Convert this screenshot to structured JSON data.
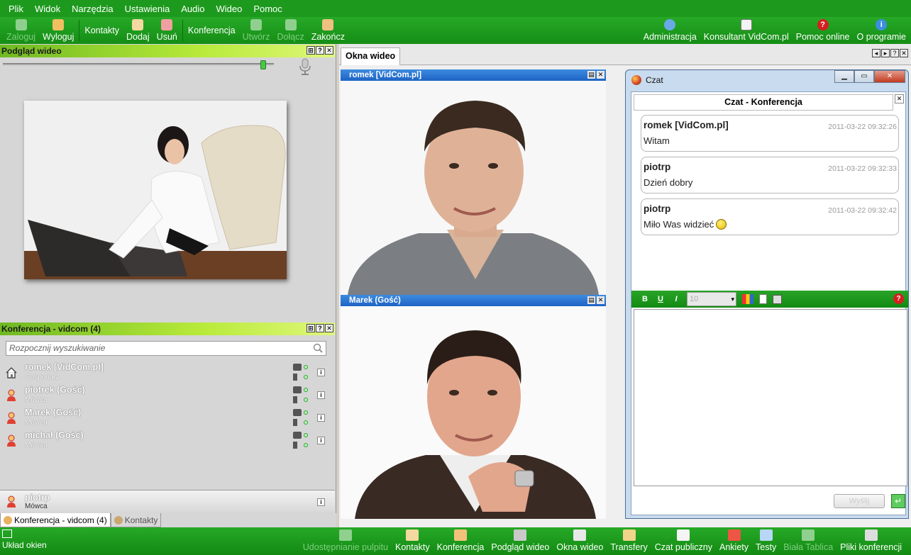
{
  "menu": [
    "Plik",
    "Widok",
    "Narzędzia",
    "Ustawienia",
    "Audio",
    "Wideo",
    "Pomoc"
  ],
  "toolbar": {
    "zaloguj": "Zaloguj",
    "wyloguj": "Wyloguj",
    "kontakty": "Kontakty",
    "dodaj": "Dodaj",
    "usun": "Usuń",
    "konferencja": "Konferencja",
    "utworz": "Utwórz",
    "dolacz": "Dołącz",
    "zakoncz": "Zakończ",
    "administracja": "Administracja",
    "konsultant": "Konsultant VidCom.pl",
    "pomoc_online": "Pomoc online",
    "o_programie": "O programie"
  },
  "preview": {
    "title": "Podgląd wideo",
    "volume": 0.97
  },
  "conference": {
    "title": "Konferencja - vidcom (4)",
    "search_placeholder": "Rozpocznij wyszukiwanie",
    "participants": [
      {
        "name": "romek [VidCom.pl]",
        "role": "Gospodarz"
      },
      {
        "name": "piotrek (Gość)",
        "role": "Mówca"
      },
      {
        "name": "Marek (Gość)",
        "role": "Mówca"
      },
      {
        "name": "michał (Gość)",
        "role": "Mówca"
      }
    ],
    "bottom_item": {
      "name": "piotrp",
      "role": "Mówca"
    }
  },
  "left_tabs": [
    "Konferencja - vidcom (4)",
    "Kontakty"
  ],
  "right_tab": "Okna wideo",
  "videos": [
    {
      "title": "romek [VidCom.pl]"
    },
    {
      "title": "Marek (Gość)"
    }
  ],
  "chat": {
    "window_title": "Czat",
    "header": "Czat - Konferencja",
    "messages": [
      {
        "author": "romek [VidCom.pl]",
        "time": "2011-03-22 09:32:26",
        "text": "Witam"
      },
      {
        "author": "piotrp",
        "time": "2011-03-22 09:32:33",
        "text": "Dzień dobry"
      },
      {
        "author": "piotrp",
        "time": "2011-03-22 09:32:42",
        "text": "Miło Was widzieć"
      }
    ],
    "format": {
      "bold": "B",
      "underline": "U",
      "italic": "I",
      "size": "10"
    },
    "send_label": "Wyślij"
  },
  "statusbar": {
    "layout": "Układ okien",
    "items": [
      {
        "label": "Udostępnianie pulpitu",
        "disabled": true
      },
      {
        "label": "Kontakty",
        "disabled": false
      },
      {
        "label": "Konferencja",
        "disabled": false
      },
      {
        "label": "Podgląd wideo",
        "disabled": false
      },
      {
        "label": "Okna wideo",
        "disabled": false
      },
      {
        "label": "Transfery",
        "disabled": false
      },
      {
        "label": "Czat publiczny",
        "disabled": false
      },
      {
        "label": "Ankiety",
        "disabled": false
      },
      {
        "label": "Testy",
        "disabled": false
      },
      {
        "label": "Biała Tablica",
        "disabled": true
      },
      {
        "label": "Pliki konferencji",
        "disabled": false
      }
    ]
  },
  "colors": {
    "accent": "#1d9a1d",
    "title_blue": "#1e63c4",
    "panel_lime": "#b8ea3a"
  }
}
